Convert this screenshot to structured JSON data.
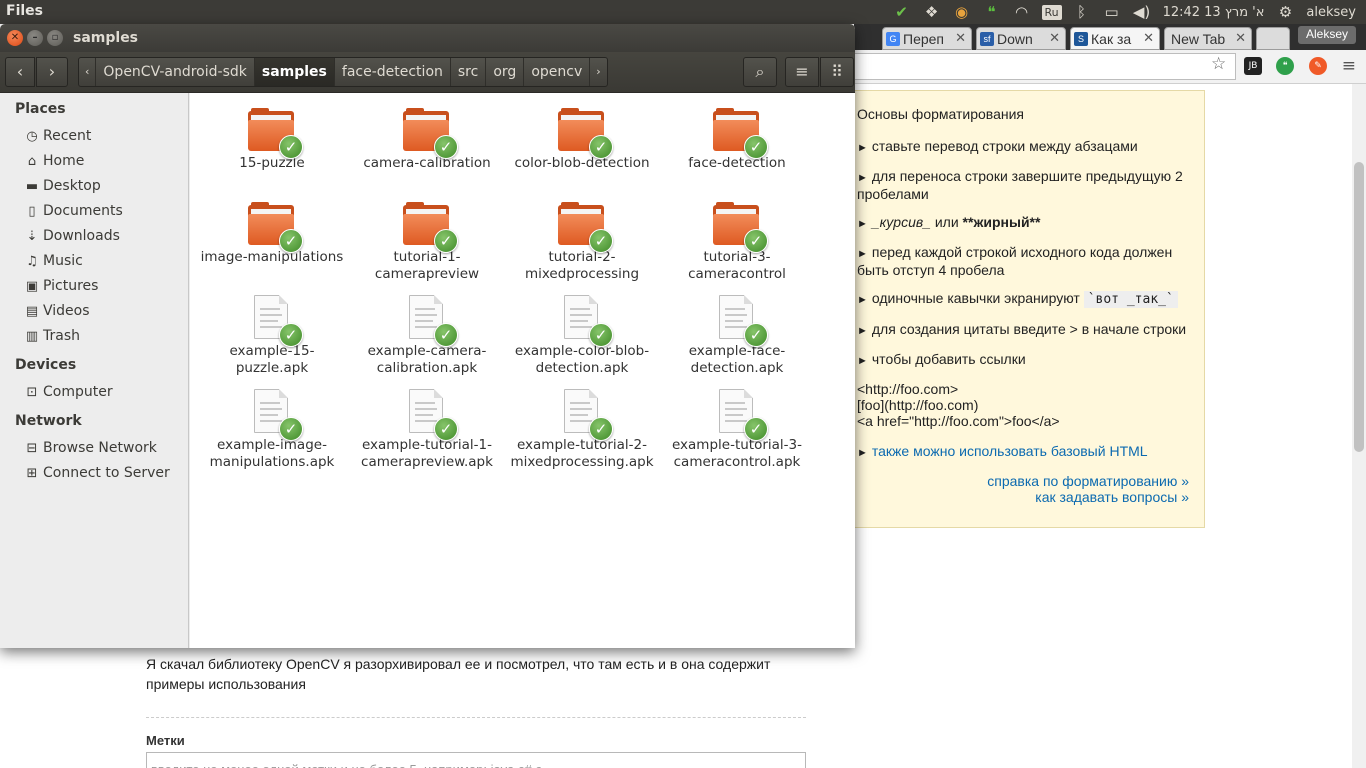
{
  "panel": {
    "app_title": "Files",
    "keyboard_layout": "Ru",
    "clock": "12:42 13 א' מרץ",
    "user": "aleksey"
  },
  "browser": {
    "tabs": [
      {
        "label": "Переп",
        "favicon": "google-icon",
        "color": "#4285f4"
      },
      {
        "label": "Down",
        "favicon": "sourceforge-icon",
        "color": "#2a5ea8"
      },
      {
        "label": "Как за",
        "favicon": "stackexchange-icon",
        "color": "#1e5799"
      },
      {
        "label": "New Tab",
        "favicon": "",
        "color": ""
      }
    ],
    "profile_name": "Aleksey",
    "help": {
      "title": "Основы форматирования",
      "items": [
        "ставьте перевод строки между абзацами",
        "для переноса строки завершите предыдущую 2 пробелами",
        "перед каждой строкой исходного кода должен быть отступ 4 пробела",
        "одиночные кавычки экранируют",
        "для создания цитаты введите > в начале строки",
        "чтобы добавить ссылки"
      ],
      "italic_sample": "_курсив_",
      "italic_join": "или",
      "bold_sample": "**жирный**",
      "code_sample": "`вот _так_`",
      "link_examples": [
        "<http://foo.com>",
        "[foo](http://foo.com)",
        "<a href=\"http://foo.com\">foo</a>"
      ],
      "html_link": "также можно использовать базовый HTML",
      "footer_links": [
        "справка по форматированию »",
        "как задавать вопросы »"
      ]
    },
    "question_text": "Я скачал библиотеку OpenCV я разорхивировал ее и посмотрел, что там есть и в она содержит примеры использования",
    "tags_label": "Метки",
    "tags_placeholder": "введите не менее одной метки и не более 5, например: java c# c..."
  },
  "files_window": {
    "title": "samples",
    "breadcrumbs": [
      "OpenCV-android-sdk",
      "samples",
      "face-detection",
      "src",
      "org",
      "opencv"
    ],
    "current_crumb": "samples",
    "sidebar": {
      "places_header": "Places",
      "places": [
        {
          "label": "Recent",
          "icon": "clock-icon"
        },
        {
          "label": "Home",
          "icon": "home-icon"
        },
        {
          "label": "Desktop",
          "icon": "folder-icon"
        },
        {
          "label": "Documents",
          "icon": "document-icon"
        },
        {
          "label": "Downloads",
          "icon": "download-icon"
        },
        {
          "label": "Music",
          "icon": "music-icon"
        },
        {
          "label": "Pictures",
          "icon": "picture-icon"
        },
        {
          "label": "Videos",
          "icon": "video-icon"
        },
        {
          "label": "Trash",
          "icon": "trash-icon"
        }
      ],
      "devices_header": "Devices",
      "devices": [
        {
          "label": "Computer",
          "icon": "drive-icon"
        }
      ],
      "network_header": "Network",
      "network": [
        {
          "label": "Browse Network",
          "icon": "network-icon"
        },
        {
          "label": "Connect to Server",
          "icon": "server-icon"
        }
      ]
    },
    "files": [
      {
        "label": "15-puzzle",
        "kind": "folder"
      },
      {
        "label": "camera-calibration",
        "kind": "folder"
      },
      {
        "label": "color-blob-detection",
        "kind": "folder"
      },
      {
        "label": "face-detection",
        "kind": "folder"
      },
      {
        "label": "image-manipulations",
        "kind": "folder"
      },
      {
        "label": "tutorial-1-camerapreview",
        "kind": "folder"
      },
      {
        "label": "tutorial-2-mixedprocessing",
        "kind": "folder"
      },
      {
        "label": "tutorial-3-cameracontrol",
        "kind": "folder"
      },
      {
        "label": "example-15-puzzle.apk",
        "kind": "file"
      },
      {
        "label": "example-camera-calibration.apk",
        "kind": "file"
      },
      {
        "label": "example-color-blob-detection.apk",
        "kind": "file"
      },
      {
        "label": "example-face-detection.apk",
        "kind": "file"
      },
      {
        "label": "example-image-manipulations.apk",
        "kind": "file"
      },
      {
        "label": "example-tutorial-1-camerapreview.apk",
        "kind": "file"
      },
      {
        "label": "example-tutorial-2-mixedprocessing.apk",
        "kind": "file"
      },
      {
        "label": "example-tutorial-3-cameracontrol.apk",
        "kind": "file"
      }
    ]
  }
}
